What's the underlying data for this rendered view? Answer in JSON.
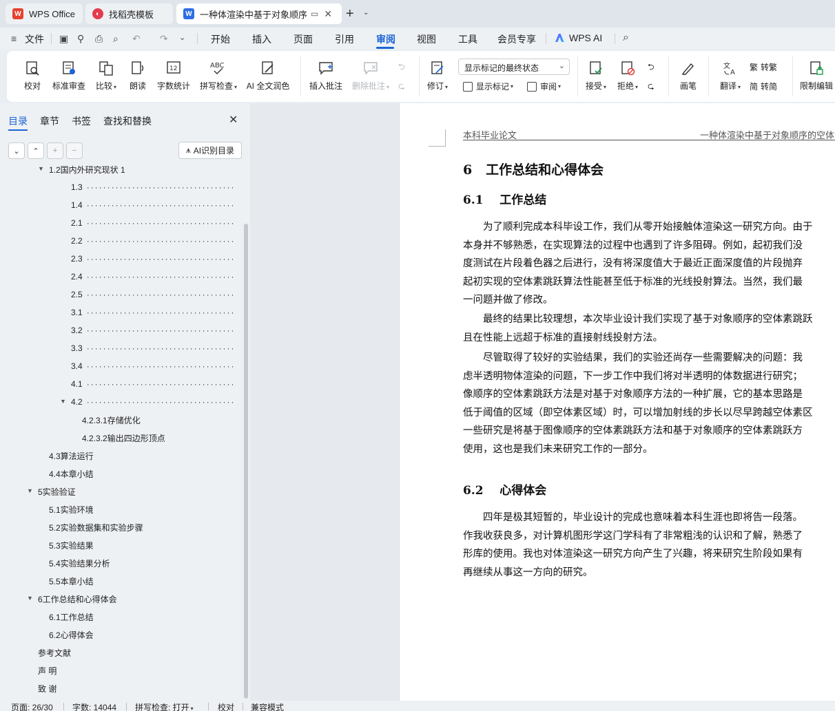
{
  "tabs": [
    {
      "label": "WPS Office",
      "icon": "wps-logo-icon"
    },
    {
      "label": "找稻壳模板",
      "icon": "docer-icon"
    },
    {
      "label": "一种体渲染中基于对象顺序的",
      "icon": "writer-doc-icon",
      "active": true
    }
  ],
  "menu": {
    "file": "文件",
    "items": [
      "开始",
      "插入",
      "页面",
      "引用",
      "审阅",
      "视图",
      "工具",
      "会员专享"
    ],
    "active": "审阅",
    "wps_ai": "WPS AI"
  },
  "ribbon": {
    "proofread": "校对",
    "standard_review": "标准审查",
    "compare": "比较",
    "read_aloud": "朗读",
    "word_count": "字数统计",
    "spell_check": "拼写检查",
    "ai_polish": "AI 全文润色",
    "insert_comment": "插入批注",
    "delete_comment": "删除批注",
    "track_changes": "修订",
    "markup_select": "显示标记的最终状态",
    "show_markup": "显示标记",
    "review_pane": "审阅",
    "accept": "接受",
    "reject": "拒绝",
    "pen": "画笔",
    "translate": "翻译",
    "to_traditional": "转繁",
    "to_simplified": "转简",
    "restrict_editing": "限制编辑"
  },
  "panel": {
    "tabs": [
      "目录",
      "章节",
      "书签",
      "查找和替换"
    ],
    "active_tab": "目录",
    "ai_toc": "AI识别目录",
    "toc": [
      {
        "label": "1.2国内外研究现状 1",
        "level": 1,
        "arrow": true,
        "dots": false
      },
      {
        "label": "1.3",
        "level": 2,
        "dots": true
      },
      {
        "label": "1.4",
        "level": 2,
        "dots": true
      },
      {
        "label": "2.1",
        "level": 2,
        "dots": true
      },
      {
        "label": "2.2",
        "level": 2,
        "dots": true
      },
      {
        "label": "2.3",
        "level": 2,
        "dots": true
      },
      {
        "label": "2.4",
        "level": 2,
        "dots": true
      },
      {
        "label": "2.5",
        "level": 2,
        "dots": true
      },
      {
        "label": "3.1",
        "level": 2,
        "dots": true
      },
      {
        "label": "3.2",
        "level": 2,
        "dots": true
      },
      {
        "label": "3.3",
        "level": 2,
        "dots": true
      },
      {
        "label": "3.4",
        "level": 2,
        "dots": true
      },
      {
        "label": "4.1",
        "level": 2,
        "dots": true
      },
      {
        "label": "4.2",
        "level": 2,
        "dots": true,
        "arrow": true
      },
      {
        "label": "4.2.3.1存储优化",
        "level": 3,
        "dots": false
      },
      {
        "label": "4.2.3.2输出四边形顶点",
        "level": 3,
        "dots": false
      },
      {
        "label": "4.3算法运行",
        "level": 1,
        "dots": false
      },
      {
        "label": "4.4本章小结",
        "level": 1,
        "dots": false
      },
      {
        "label": "5实验验证",
        "level": 0,
        "arrow": true,
        "dots": false
      },
      {
        "label": "5.1实验环境",
        "level": 1,
        "dots": false
      },
      {
        "label": "5.2实验数据集和实验步骤",
        "level": 1,
        "dots": false
      },
      {
        "label": "5.3实验结果",
        "level": 1,
        "dots": false
      },
      {
        "label": "5.4实验结果分析",
        "level": 1,
        "dots": false
      },
      {
        "label": "5.5本章小结",
        "level": 1,
        "dots": false
      },
      {
        "label": "6工作总结和心得体会",
        "level": 0,
        "arrow": true,
        "dots": false
      },
      {
        "label": "6.1工作总结",
        "level": 1,
        "dots": false
      },
      {
        "label": "6.2心得体会",
        "level": 1,
        "dots": false
      },
      {
        "label": "参考文献",
        "level": 0,
        "dots": false
      },
      {
        "label": "声 明",
        "level": 0,
        "dots": false
      },
      {
        "label": "致 谢",
        "level": 0,
        "dots": false
      }
    ]
  },
  "document": {
    "header_left": "本科毕业论文",
    "header_right": "一种体渲染中基于对象顺序的空体素跳跃算法",
    "chapter_title": "6   工作总结和心得体会",
    "sec1_title": "6.1    工作总结",
    "p1": [
      "　　为了顺利完成本科毕设工作，我们从零开始接触体渲染这一研究方向。由于",
      "本身并不够熟悉，在实现算法的过程中也遇到了许多阻碍。例如，起初我们没",
      "度测试在片段着色器之后进行，没有将深度值大于最近正面深度值的片段抛弃",
      "起初实现的空体素跳跃算法性能甚至低于标准的光线投射算法。当然，我们最",
      "一问题并做了修改。"
    ],
    "p2": [
      "　　最终的结果比较理想，本次毕业设计我们实现了基于对象顺序的空体素跳跃",
      "且在性能上远超于标准的直接射线投射方法。"
    ],
    "p3": [
      "　　尽管取得了较好的实验结果，我们的实验还尚存一些需要解决的问题：我",
      "虑半透明物体渲染的问题，下一步工作中我们将对半透明的体数据进行研究；",
      "像顺序的空体素跳跃方法是对基于对象顺序方法的一种扩展，它的基本思路是",
      "低于阈值的区域（即空体素区域）时，可以增加射线的步长以尽早跨越空体素区",
      "一些研究是将基于图像顺序的空体素跳跃方法和基于对象顺序的空体素跳跃方",
      "使用，这也是我们未来研究工作的一部分。"
    ],
    "sec2_title": "6.2    心得体会",
    "p4": [
      "　　四年是极其短暂的，毕业设计的完成也意味着本科生涯也即将告一段落。",
      "作我收获良多，对计算机图形学这门学科有了非常粗浅的认识和了解，熟悉了",
      "形库的使用。我也对体渲染这一研究方向产生了兴趣，将来研究生阶段如果有",
      "再继续从事这一方向的研究。"
    ]
  },
  "status": {
    "page": "页面: 26/30",
    "words": "字数: 14044",
    "spell": "拼写检查: 打开",
    "proof": "校对",
    "compat": "兼容模式"
  }
}
